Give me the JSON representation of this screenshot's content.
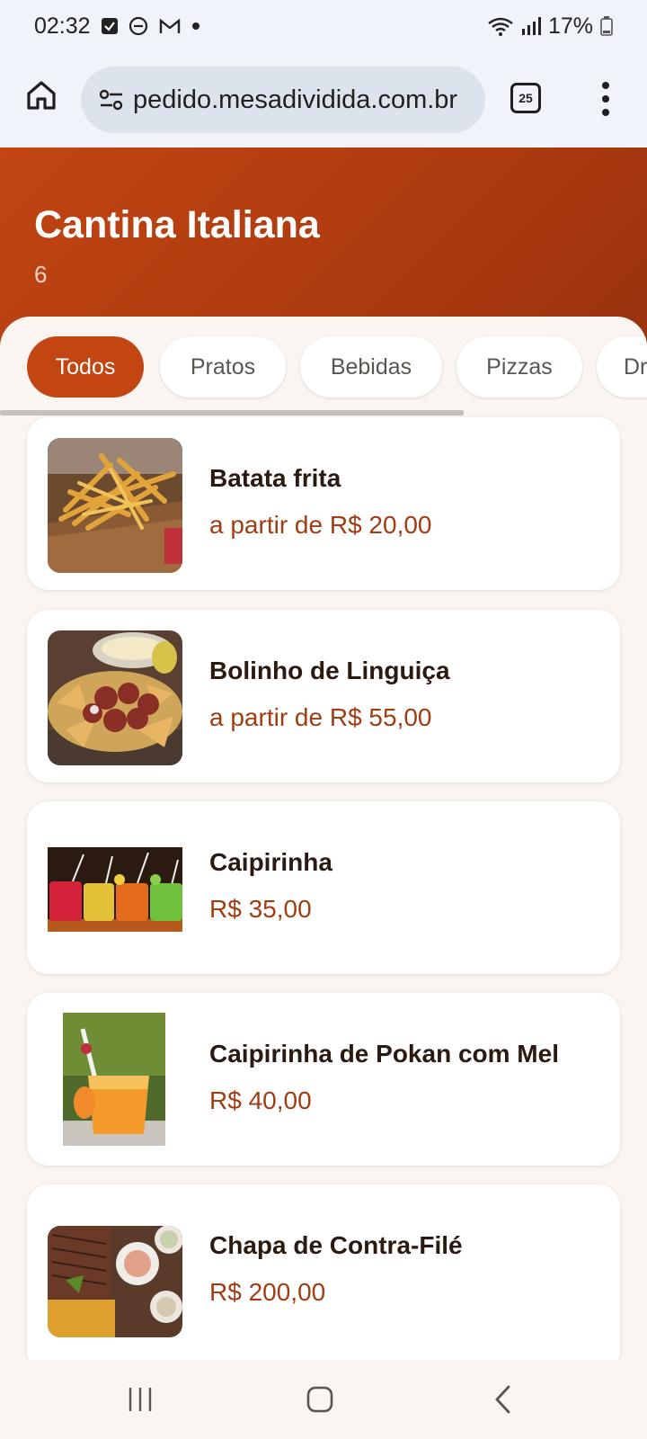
{
  "status_bar": {
    "time": "02:32",
    "battery": "17%",
    "icons": [
      "check-square-icon",
      "do-not-disturb-icon",
      "gmail-icon",
      "dot-icon",
      "wifi-icon",
      "signal-icon",
      "battery-icon"
    ]
  },
  "browser": {
    "url": "pedido.mesadividida.com.br",
    "tab_count": "25",
    "icons": [
      "home-icon",
      "tune-icon",
      "tabs-icon",
      "more-vert-icon"
    ]
  },
  "restaurant": {
    "name": "Cantina Italiana",
    "subtitle": "6",
    "header_color": "#c24512"
  },
  "categories": [
    {
      "label": "Todos",
      "active": true
    },
    {
      "label": "Pratos",
      "active": false
    },
    {
      "label": "Bebidas",
      "active": false
    },
    {
      "label": "Pizzas",
      "active": false
    },
    {
      "label": "Dr",
      "active": false
    }
  ],
  "items": [
    {
      "name": "Batata frita",
      "price": "a partir de R$ 20,00",
      "image": "french-fries-photo"
    },
    {
      "name": "Bolinho de Linguiça",
      "price": "a partir de R$ 55,00",
      "image": "sausage-balls-photo"
    },
    {
      "name": "Caipirinha",
      "price": "R$ 35,00",
      "image": "caipirinha-photo"
    },
    {
      "name": "Caipirinha de Pokan com Mel",
      "price": "R$ 40,00",
      "image": "pokan-caipirinha-photo"
    },
    {
      "name": "Chapa de Contra-Filé",
      "price": "R$ 200,00",
      "image": "steak-platter-photo"
    }
  ],
  "colors": {
    "accent": "#c24512",
    "price": "#a13d12",
    "background": "#faf5f1"
  },
  "nav": {
    "icons": [
      "recent-apps-icon",
      "home-nav-icon",
      "back-icon"
    ]
  }
}
